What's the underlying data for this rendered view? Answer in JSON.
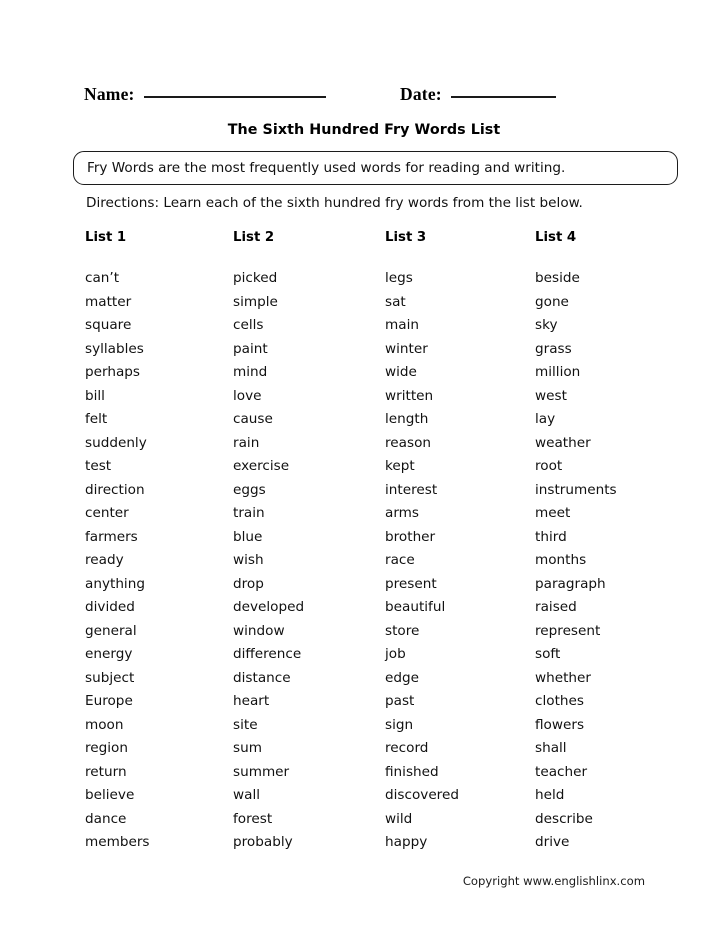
{
  "header": {
    "name_label": "Name:",
    "date_label": "Date:"
  },
  "title": "The Sixth Hundred Fry Words List",
  "info_box": {
    "text": "Fry Words are the most frequently used words for reading and writing."
  },
  "directions": "Directions: Learn each of the sixth hundred fry words from the list below.",
  "columns": [
    {
      "heading": "List 1",
      "words": [
        "can’t",
        "matter",
        "square",
        "syllables",
        "perhaps",
        "bill",
        "felt",
        "suddenly",
        "test",
        "direction",
        "center",
        "farmers",
        "ready",
        "anything",
        "divided",
        "general",
        "energy",
        "subject",
        "Europe",
        "moon",
        "region",
        "return",
        "believe",
        "dance",
        "members"
      ]
    },
    {
      "heading": "List 2",
      "words": [
        "picked",
        "simple",
        "cells",
        "paint",
        "mind",
        "love",
        "cause",
        "rain",
        "exercise",
        "eggs",
        "train",
        "blue",
        "wish",
        "drop",
        "developed",
        "window",
        "difference",
        "distance",
        "heart",
        "site",
        "sum",
        "summer",
        "wall",
        "forest",
        "probably"
      ]
    },
    {
      "heading": "List 3",
      "words": [
        "legs",
        "sat",
        "main",
        "winter",
        "wide",
        "written",
        "length",
        "reason",
        "kept",
        "interest",
        "arms",
        "brother",
        "race",
        "present",
        "beautiful",
        "store",
        "job",
        "edge",
        "past",
        "sign",
        "record",
        "finished",
        "discovered",
        "wild",
        "happy"
      ]
    },
    {
      "heading": "List 4",
      "words": [
        "beside",
        "gone",
        "sky",
        "grass",
        "million",
        "west",
        "lay",
        "weather",
        "root",
        "instruments",
        "meet",
        "third",
        "months",
        "paragraph",
        "raised",
        "represent",
        "soft",
        "whether",
        "clothes",
        "flowers",
        "shall",
        "teacher",
        "held",
        "describe",
        "drive"
      ]
    }
  ],
  "copyright": "Copyright www.englishlinx.com"
}
